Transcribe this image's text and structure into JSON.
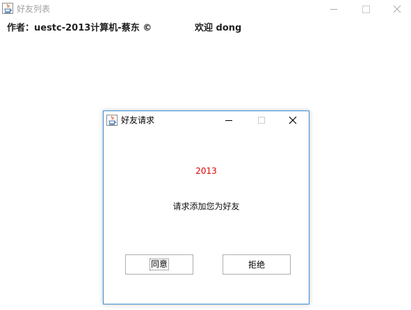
{
  "main_window": {
    "title": "好友列表",
    "author_label": "作者：uestc-2013计算机-蔡东 ©",
    "welcome_label": "欢迎  dong",
    "controls": [
      "minimize",
      "maximize",
      "close"
    ]
  },
  "dialog": {
    "title": "好友请求",
    "sender": "2013",
    "message": "请求添加您为好友",
    "accept_label": "同意",
    "reject_label": "拒绝",
    "controls": [
      "minimize",
      "maximize",
      "close"
    ]
  },
  "icons": {
    "app_icon": "java-coffee-cup-icon"
  },
  "colors": {
    "sender_text": "#e00000",
    "dialog_border": "#3d8fd4",
    "inactive_title": "#a0a0a0"
  }
}
